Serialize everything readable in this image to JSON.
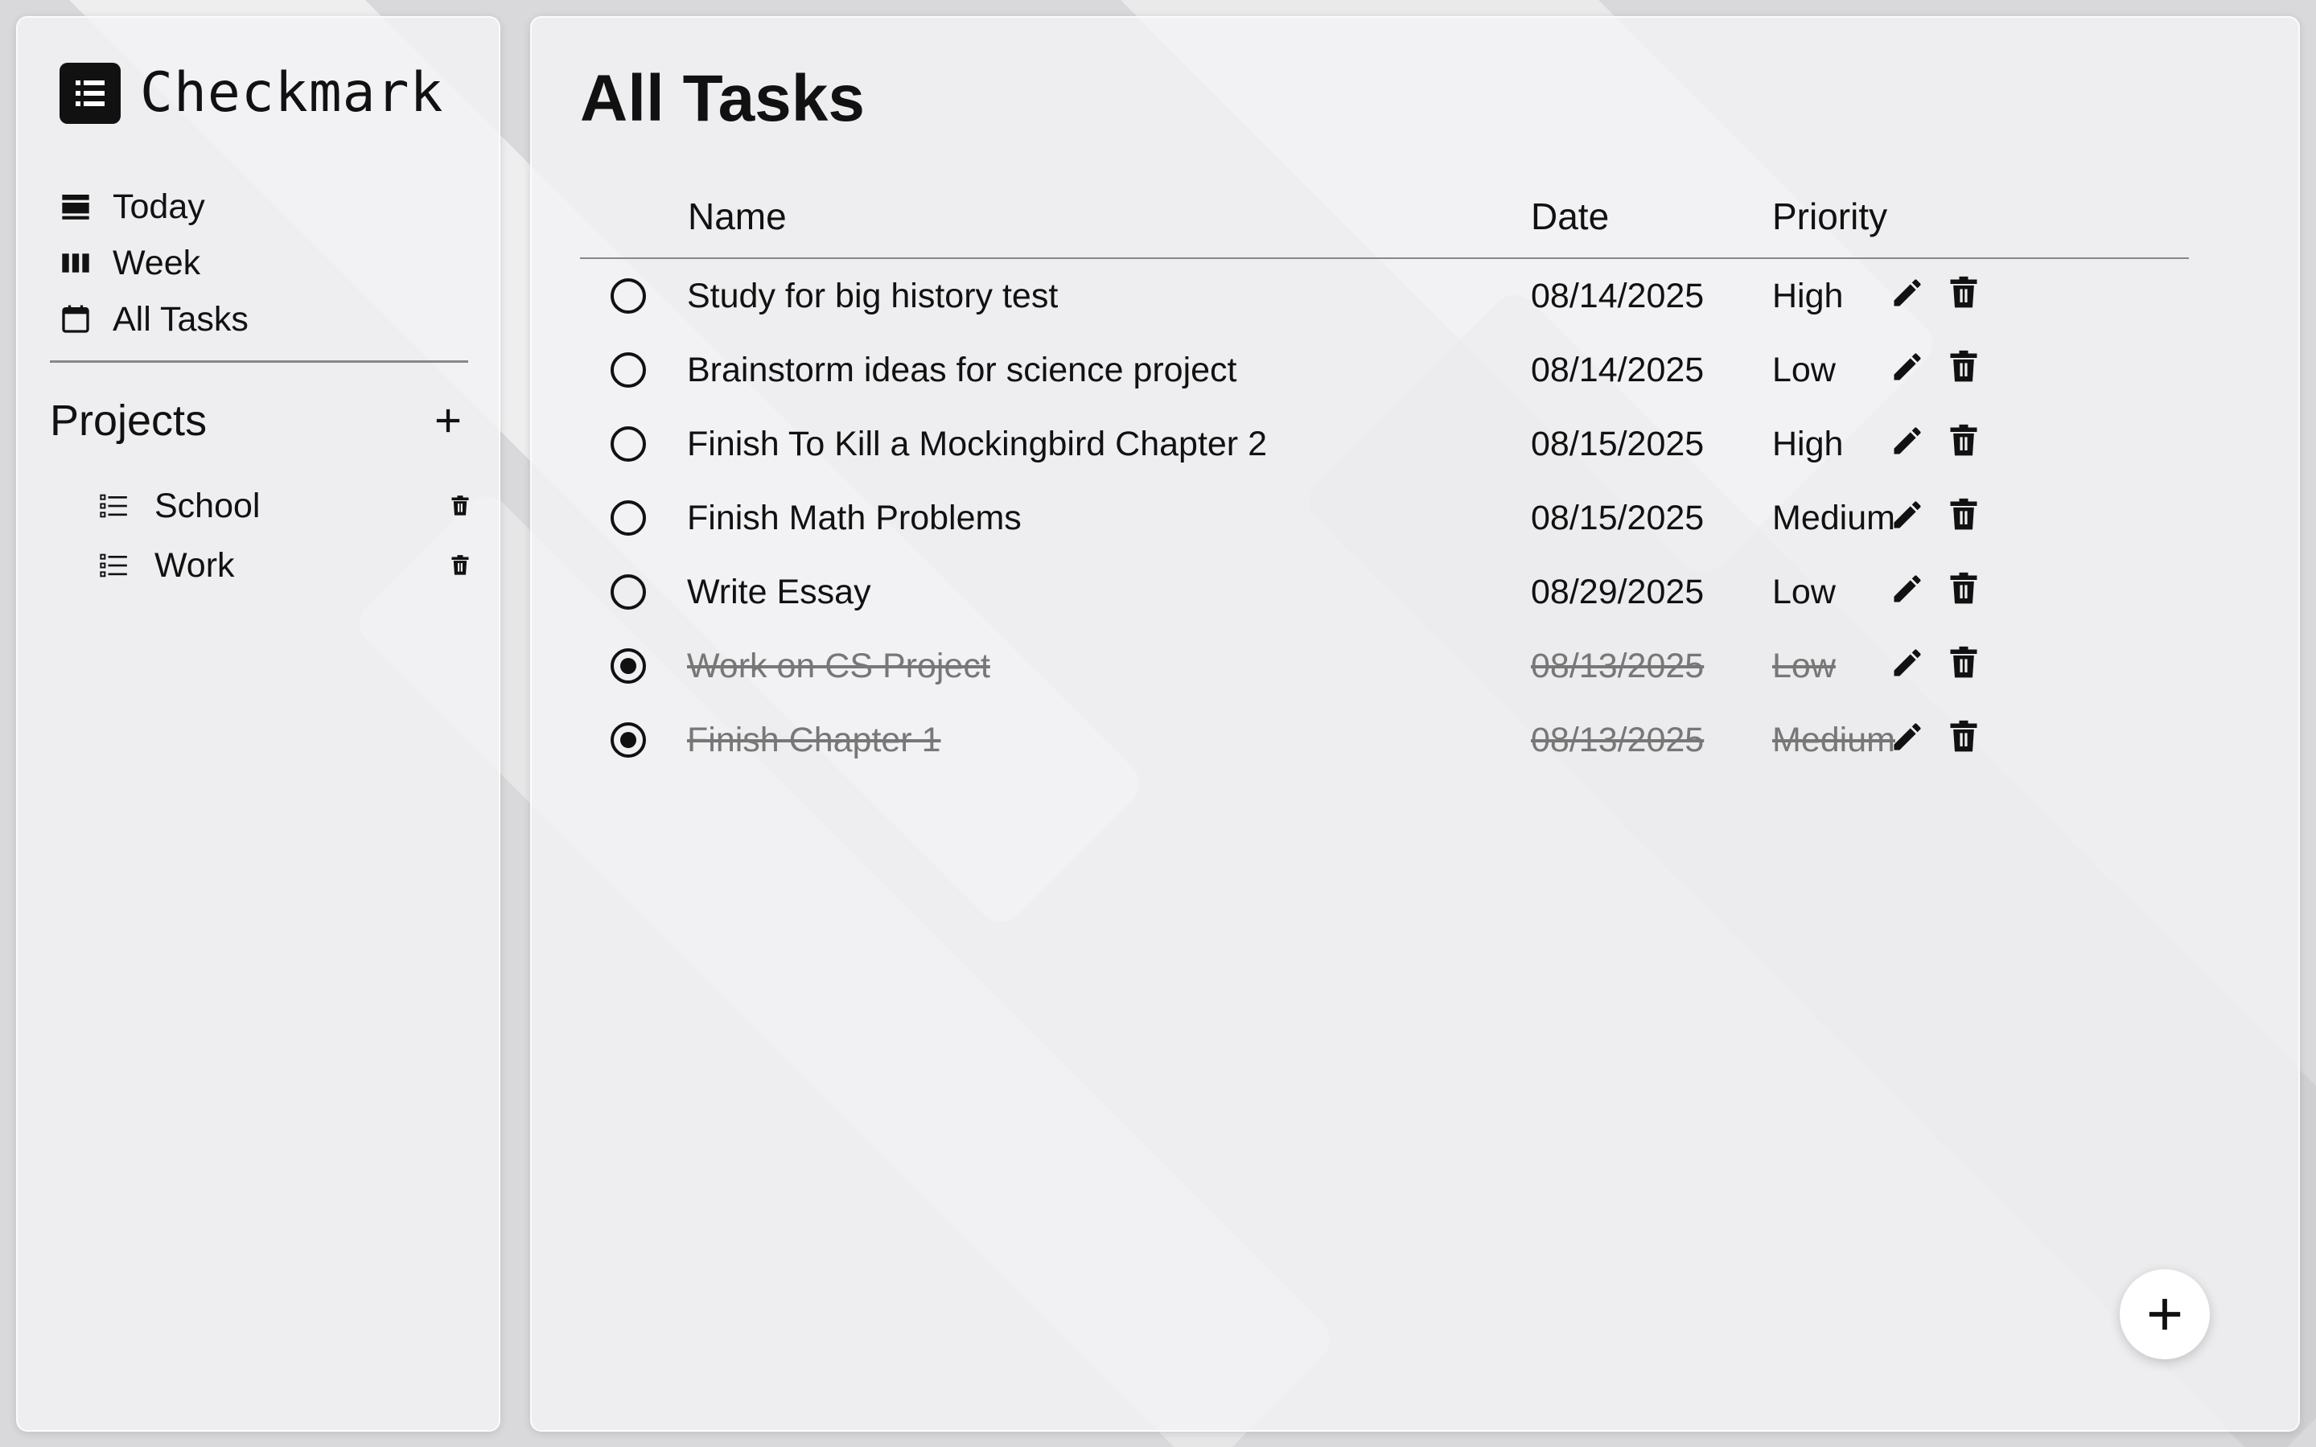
{
  "app": {
    "title": "Checkmark"
  },
  "nav": {
    "items": [
      {
        "label": "Today",
        "icon": "today-icon"
      },
      {
        "label": "Week",
        "icon": "week-icon"
      },
      {
        "label": "All Tasks",
        "icon": "calendar-icon"
      }
    ]
  },
  "projects": {
    "title": "Projects",
    "items": [
      {
        "label": "School"
      },
      {
        "label": "Work"
      }
    ]
  },
  "main": {
    "title": "All Tasks",
    "columns": {
      "name": "Name",
      "date": "Date",
      "priority": "Priority"
    },
    "tasks": [
      {
        "name": "Study for big history test",
        "date": "08/14/2025",
        "priority": "High",
        "done": false
      },
      {
        "name": "Brainstorm ideas for science project",
        "date": "08/14/2025",
        "priority": "Low",
        "done": false
      },
      {
        "name": "Finish To Kill a Mockingbird Chapter 2",
        "date": "08/15/2025",
        "priority": "High",
        "done": false
      },
      {
        "name": "Finish Math Problems",
        "date": "08/15/2025",
        "priority": "Medium",
        "done": false
      },
      {
        "name": "Write Essay",
        "date": "08/29/2025",
        "priority": "Low",
        "done": false
      },
      {
        "name": "Work on CS Project",
        "date": "08/13/2025",
        "priority": "Low",
        "done": true
      },
      {
        "name": "Finish Chapter 1",
        "date": "08/13/2025",
        "priority": "Medium",
        "done": true
      }
    ]
  },
  "icons": {
    "logo": "list-logo-icon",
    "add_project": "plus-icon",
    "project": "list-icon",
    "delete": "trash-icon",
    "edit": "pencil-icon",
    "add_task": "plus-icon"
  },
  "colors": {
    "text": "#111111",
    "done_text": "#777777",
    "panel": "#f4f4f6",
    "background": "#d9d9db"
  }
}
